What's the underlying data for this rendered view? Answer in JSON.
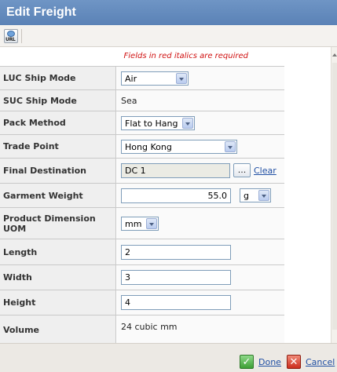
{
  "window": {
    "title": "Edit Freight"
  },
  "toolbar": {
    "url_button_text": "URL",
    "url_icon": "url-icon"
  },
  "form": {
    "required_note": "Fields in red italics are required",
    "rows": [
      {
        "label": "LUC Ship Mode",
        "type": "select",
        "value": "Air"
      },
      {
        "label": "SUC Ship Mode",
        "type": "static",
        "value": "Sea"
      },
      {
        "label": "Pack Method",
        "type": "select",
        "value": "Flat to Hang"
      },
      {
        "label": "Trade Point",
        "type": "select",
        "value": "Hong Kong"
      },
      {
        "label": "Final Destination",
        "type": "lookup",
        "value": "DC 1",
        "browse_label": "...",
        "clear_label": "Clear"
      },
      {
        "label": "Garment Weight",
        "type": "input-unit",
        "value": "55.0",
        "unit": "g"
      },
      {
        "label": "Product Dimension UOM",
        "type": "select",
        "value": "mm"
      },
      {
        "label": "Length",
        "type": "input",
        "value": "2"
      },
      {
        "label": "Width",
        "type": "input",
        "value": "3"
      },
      {
        "label": "Height",
        "type": "input",
        "value": "4"
      },
      {
        "label": "Volume",
        "type": "static",
        "value": "24 cubic mm"
      }
    ]
  },
  "footer": {
    "done_label": "Done",
    "cancel_label": "Cancel",
    "done_icon": "check-icon",
    "cancel_icon": "close-icon"
  },
  "colors": {
    "title_bar": "#5f88bc",
    "required_text": "#d01010",
    "link": "#1f4ea3",
    "label_bg": "#efefef"
  }
}
